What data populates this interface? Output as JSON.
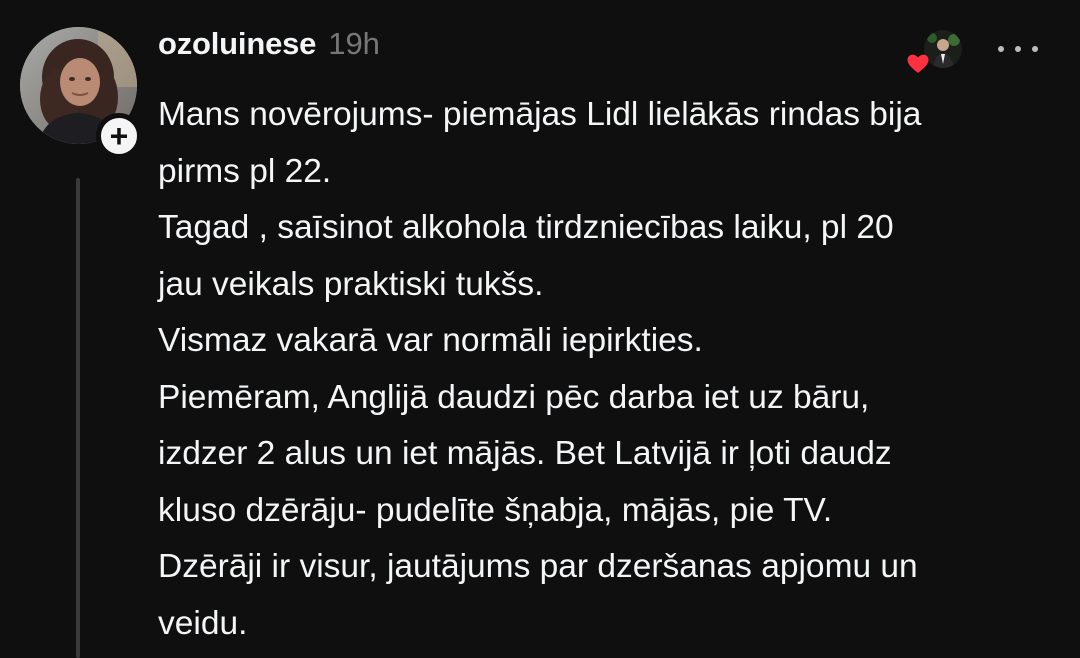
{
  "post": {
    "username": "ozoluinese",
    "timestamp": "19h",
    "follow_symbol": "+",
    "lines": [
      "Mans novērojums- piemājas Lidl lielākās rindas bija",
      "pirms pl 22.",
      "Tagad , saīsinot alkohola tirdzniecības laiku, pl 20",
      "jau veikals praktiski tukšs.",
      "Vismaz vakarā var normāli iepirkties.",
      "Piemēram, Anglijā daudzi pēc darba iet uz bāru,",
      "izdzer 2 alus un iet mājās. Bet Latvijā ir ļoti daudz",
      "kluso dzērāju- pudelīte šņabja, mājās, pie TV.",
      "Dzērāji ir visur, jautājums par dzeršanas apjomu un",
      "veidu."
    ]
  },
  "icons": {
    "follow": "plus-icon",
    "more": "more-horizontal-icon",
    "like": "heart-icon"
  },
  "colors": {
    "background": "#0f0f0f",
    "text": "#f3f5f7",
    "muted": "#777777",
    "heart": "#ff3040"
  }
}
